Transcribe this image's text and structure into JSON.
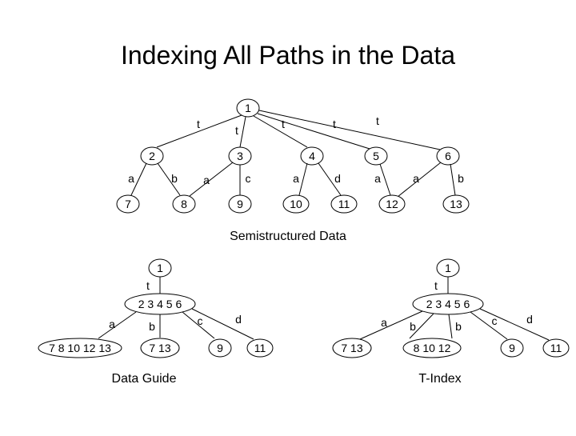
{
  "title": "Indexing All Paths in the Data",
  "section_label": "Semistructured Data",
  "top_tree": {
    "root": "1",
    "root_edges": [
      "t",
      "t",
      "t",
      "t",
      "t"
    ],
    "level1": [
      "2",
      "3",
      "4",
      "5",
      "6"
    ],
    "level1_edges": [
      [
        "a",
        "b"
      ],
      [
        "a",
        "c"
      ],
      [
        "a",
        "d"
      ],
      [
        "a"
      ],
      [
        "a",
        "b"
      ]
    ],
    "leaves": [
      "7",
      "8",
      "9",
      "10",
      "11",
      "12",
      "13"
    ]
  },
  "data_guide": {
    "label": "Data Guide",
    "root": "1",
    "root_edge": "t",
    "mid": "2 3 4 5 6",
    "mid_edges": [
      "a",
      "b",
      "c",
      "d"
    ],
    "leaves": [
      "7 8 10 12 13",
      "7 13",
      "9",
      "11"
    ]
  },
  "t_index": {
    "label": "T-Index",
    "root": "1",
    "root_edge": "t",
    "mid": "2 3 4 5 6",
    "mid_edges": [
      "a",
      "b",
      "b",
      "c",
      "d"
    ],
    "leaves": [
      "7 13",
      "8 10 12",
      "9",
      "11"
    ]
  }
}
